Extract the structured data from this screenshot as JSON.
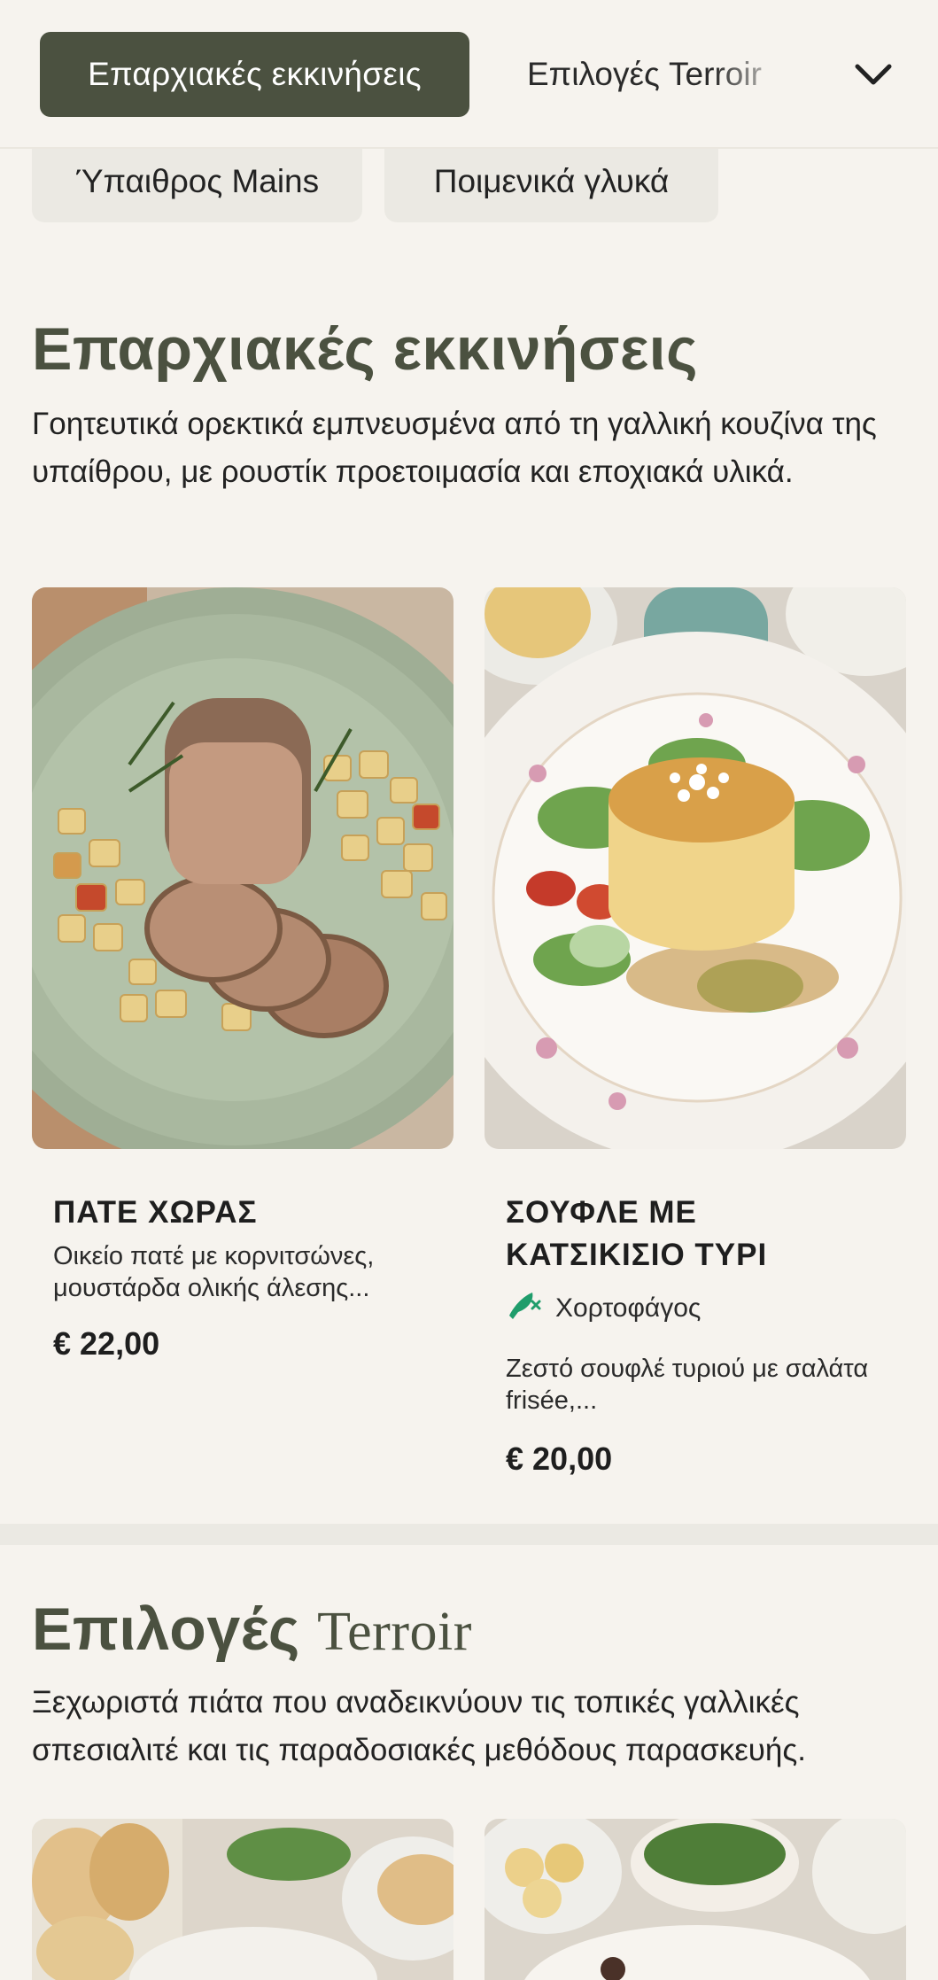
{
  "nav": {
    "active_tab": "Επαρχιακές εκκινήσεις",
    "next_tab": "Επιλογές Terroir",
    "chevron_icon": "chevron-down-icon"
  },
  "chips": [
    {
      "label": "Ύπαιθρος Mains"
    },
    {
      "label": "Ποιμενικά γλυκά"
    }
  ],
  "section1": {
    "title": "Επαρχιακές εκκινήσεις",
    "description": "Γοητευτικά ορεκτικά εμπνευσμένα από τη γαλλική κουζίνα της υπαίθρου, με ρουστίκ προετοιμασία και εποχιακά υλικά.",
    "items": [
      {
        "title": "ΠΑΤΕ ΧΩΡΑΣ",
        "description": "Οικείο πατέ με κορνιτσώνες, μουστάρδα ολικής άλεσης...",
        "price": "€ 22,00"
      },
      {
        "title": "ΣΟΥΦΛΕ ΜΕ ΚΑΤΣΙΚΙΣΙΟ ΤΥΡΙ",
        "badge": "Χορτοφάγος",
        "badge_icon": "vegetarian-icon",
        "description": "Ζεστό σουφλέ τυριού με σαλάτα frisée,...",
        "price": "€ 20,00"
      }
    ]
  },
  "section2": {
    "title_main": "Επιλογές",
    "title_serif": "Terroir",
    "description": "Ξεχωριστά πιάτα που αναδεικνύουν τις τοπικές γαλλικές σπεσιαλιτέ και τις παραδοσιακές μεθόδους παρασκευής."
  },
  "colors": {
    "accent": "#4b5140",
    "background": "#f6f3ee",
    "chip": "#ebe9e3",
    "vegetarian": "#1f9d6b"
  }
}
